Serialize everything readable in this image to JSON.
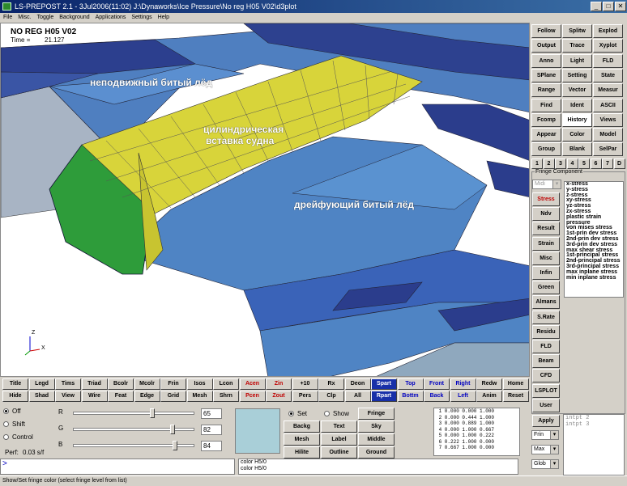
{
  "window": {
    "title": "LS-PREPOST 2.1 - 3Jul2006(11:02) J:\\Dynaworks\\Ice Pressure\\No reg H05 V02\\d3plot",
    "controls": [
      "_",
      "□",
      "✕"
    ]
  },
  "menu": [
    "File",
    "Misc.",
    "Toggle",
    "Background",
    "Applications",
    "Settings",
    "Help"
  ],
  "viewport": {
    "model_title": "NO REG H05 V02",
    "time_label": "Time =",
    "time_value": "21.127",
    "labels": {
      "fixed_ice": "неподвижный битый лёд",
      "insert_line1": "цилиндрическая",
      "insert_line2": "вставка судна",
      "drifting_ice": "дрейфующий битый лёд"
    },
    "axes": {
      "x": "X",
      "z": "Z"
    }
  },
  "right_panel": {
    "buttons": [
      [
        "Follow",
        "Splitw",
        "Explod"
      ],
      [
        "Output",
        "Trace",
        "Xyplot"
      ],
      [
        "Anno",
        "Light",
        "FLD"
      ],
      [
        "SPlane",
        "Setting",
        "State"
      ],
      [
        "Range",
        "Vector",
        "Measur"
      ],
      [
        "Find",
        "Ident",
        "ASCII"
      ],
      [
        "Fcomp",
        "History",
        "Views"
      ],
      [
        "Appear",
        "Color",
        "Model"
      ],
      [
        "Group",
        "Blank",
        "SelPar"
      ]
    ],
    "page_tabs": [
      "1",
      "2",
      "3",
      "4",
      "5",
      "6",
      "7",
      "D"
    ],
    "fringe_title": "Fringe Component",
    "fringe_select": "Midi",
    "fringe_side": [
      "Stress",
      "Ndv",
      "Result",
      "Strain",
      "Misc",
      "Infin",
      "Green",
      "Almans",
      "S.Rate",
      "Residu",
      "FLD",
      "Beam",
      "CFD",
      "LSPLOT",
      "User"
    ],
    "fringe_list": [
      "x-stress",
      "y-stress",
      "z-stress",
      "xy-stress",
      "yz-stress",
      "zx-stress",
      "plastic strain",
      "pressure",
      "von mises stress",
      "1st-prin dev stress",
      "2nd-prin dev stress",
      "3rd-prin dev stress",
      "max shear stress",
      "1st-principal stress",
      "2nd-principal stress",
      "3rd-principal stress",
      "max inplane stress",
      "min inplane stress"
    ],
    "apply": "Apply",
    "intpt_lines": [
      "intpt 2",
      "intpt 3"
    ],
    "frin_select": "Frin",
    "max_select": "Max",
    "glob_select": "Glob"
  },
  "toolbar": {
    "row1": [
      "Title",
      "Legd",
      "Tims",
      "Triad",
      "Bcolr",
      "Mcolr",
      "Frin",
      "Isos",
      "Lcon",
      "Acen",
      "Zin",
      "+10",
      "Rx",
      "Deon",
      "Spart",
      "Top",
      "Front",
      "Right",
      "Redw",
      "Home"
    ],
    "row2": [
      "Hide",
      "Shad",
      "View",
      "Wire",
      "Feat",
      "Edge",
      "Grid",
      "Mesh",
      "Shrn",
      "Pcen",
      "Zout",
      "Pers",
      "Clp",
      "All",
      "Rpart",
      "Bottm",
      "Back",
      "Left",
      "Anim",
      "Reset"
    ]
  },
  "bottom": {
    "modes": [
      "Off",
      "Shift",
      "Control"
    ],
    "perf_label": "Perf:",
    "perf_value": "0.03 s/f",
    "rgb": [
      {
        "label": "R",
        "value": "65",
        "level": 0.65
      },
      {
        "label": "G",
        "value": "82",
        "level": 0.82
      },
      {
        "label": "B",
        "value": "84",
        "level": 0.84
      }
    ],
    "swatch_color": "#a9cfd8",
    "set_label": "Set",
    "show_label": "Show",
    "grid_buttons": [
      [
        "Fringe"
      ],
      [
        "Backg",
        "Text",
        "Sky"
      ],
      [
        "Mesh",
        "Label",
        "Middle"
      ],
      [
        "Hilite",
        "Outline",
        "Ground"
      ]
    ],
    "color_table": [
      " 1 0.000 0.000 1.000",
      " 2 0.000 0.444 1.000",
      " 3 0.000 0.889 1.000",
      " 4 0.000 1.000 0.667",
      " 5 0.000 1.000 0.222",
      " 6 0.222 1.000 0.000",
      " 7 0.667 1.000 0.000"
    ]
  },
  "command": {
    "prompt": ">",
    "log": [
      "color H5/0",
      "color H5/0"
    ]
  },
  "status": "Show/Set fringe color (select fringe level from list)",
  "colors": {
    "ice_dark": "#2b3d8c",
    "ice_mid": "#4f84c4",
    "ice_light": "#8aa6c4",
    "hull_yellow": "#d8d43a",
    "hull_green": "#2e9c3a"
  }
}
